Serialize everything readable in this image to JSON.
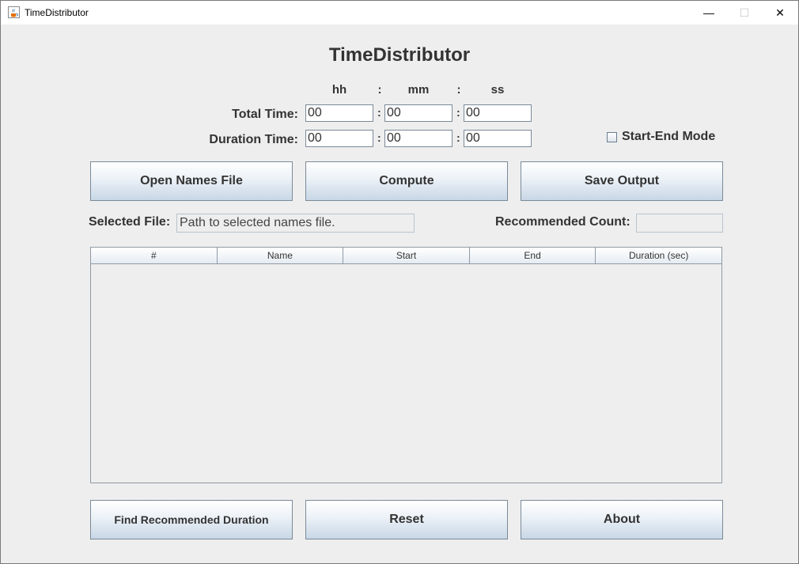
{
  "window": {
    "title": "TimeDistributor",
    "controls": {
      "minimize": "—",
      "maximize": "☐",
      "close": "✕"
    }
  },
  "heading": "TimeDistributor",
  "time_units": {
    "hh": "hh",
    "sep1": ":",
    "mm": "mm",
    "sep2": ":",
    "ss": "ss"
  },
  "total_time": {
    "label": "Total Time:",
    "hh": "00",
    "mm": "00",
    "ss": "00"
  },
  "duration_time": {
    "label": "Duration Time:",
    "hh": "00",
    "mm": "00",
    "ss": "00"
  },
  "colon": ":",
  "start_end_mode": {
    "label": "Start-End Mode",
    "checked": false
  },
  "buttons": {
    "open_names_file": "Open Names File",
    "compute": "Compute",
    "save_output": "Save Output",
    "find_recommended_duration": "Find Recommended Duration",
    "reset": "Reset",
    "about": "About"
  },
  "selected_file": {
    "label": "Selected File:",
    "value": "Path to selected names file."
  },
  "recommended_count": {
    "label": "Recommended Count:",
    "value": ""
  },
  "table": {
    "columns": [
      "#",
      "Name",
      "Start",
      "End",
      "Duration (sec)"
    ],
    "rows": []
  },
  "colors": {
    "background": "#eeeeee",
    "button_gradient_top": "#ffffff",
    "button_gradient_bottom": "#c8d7e6",
    "border": "#7a8a99"
  },
  "icons": {
    "app": "java-cup-icon"
  }
}
